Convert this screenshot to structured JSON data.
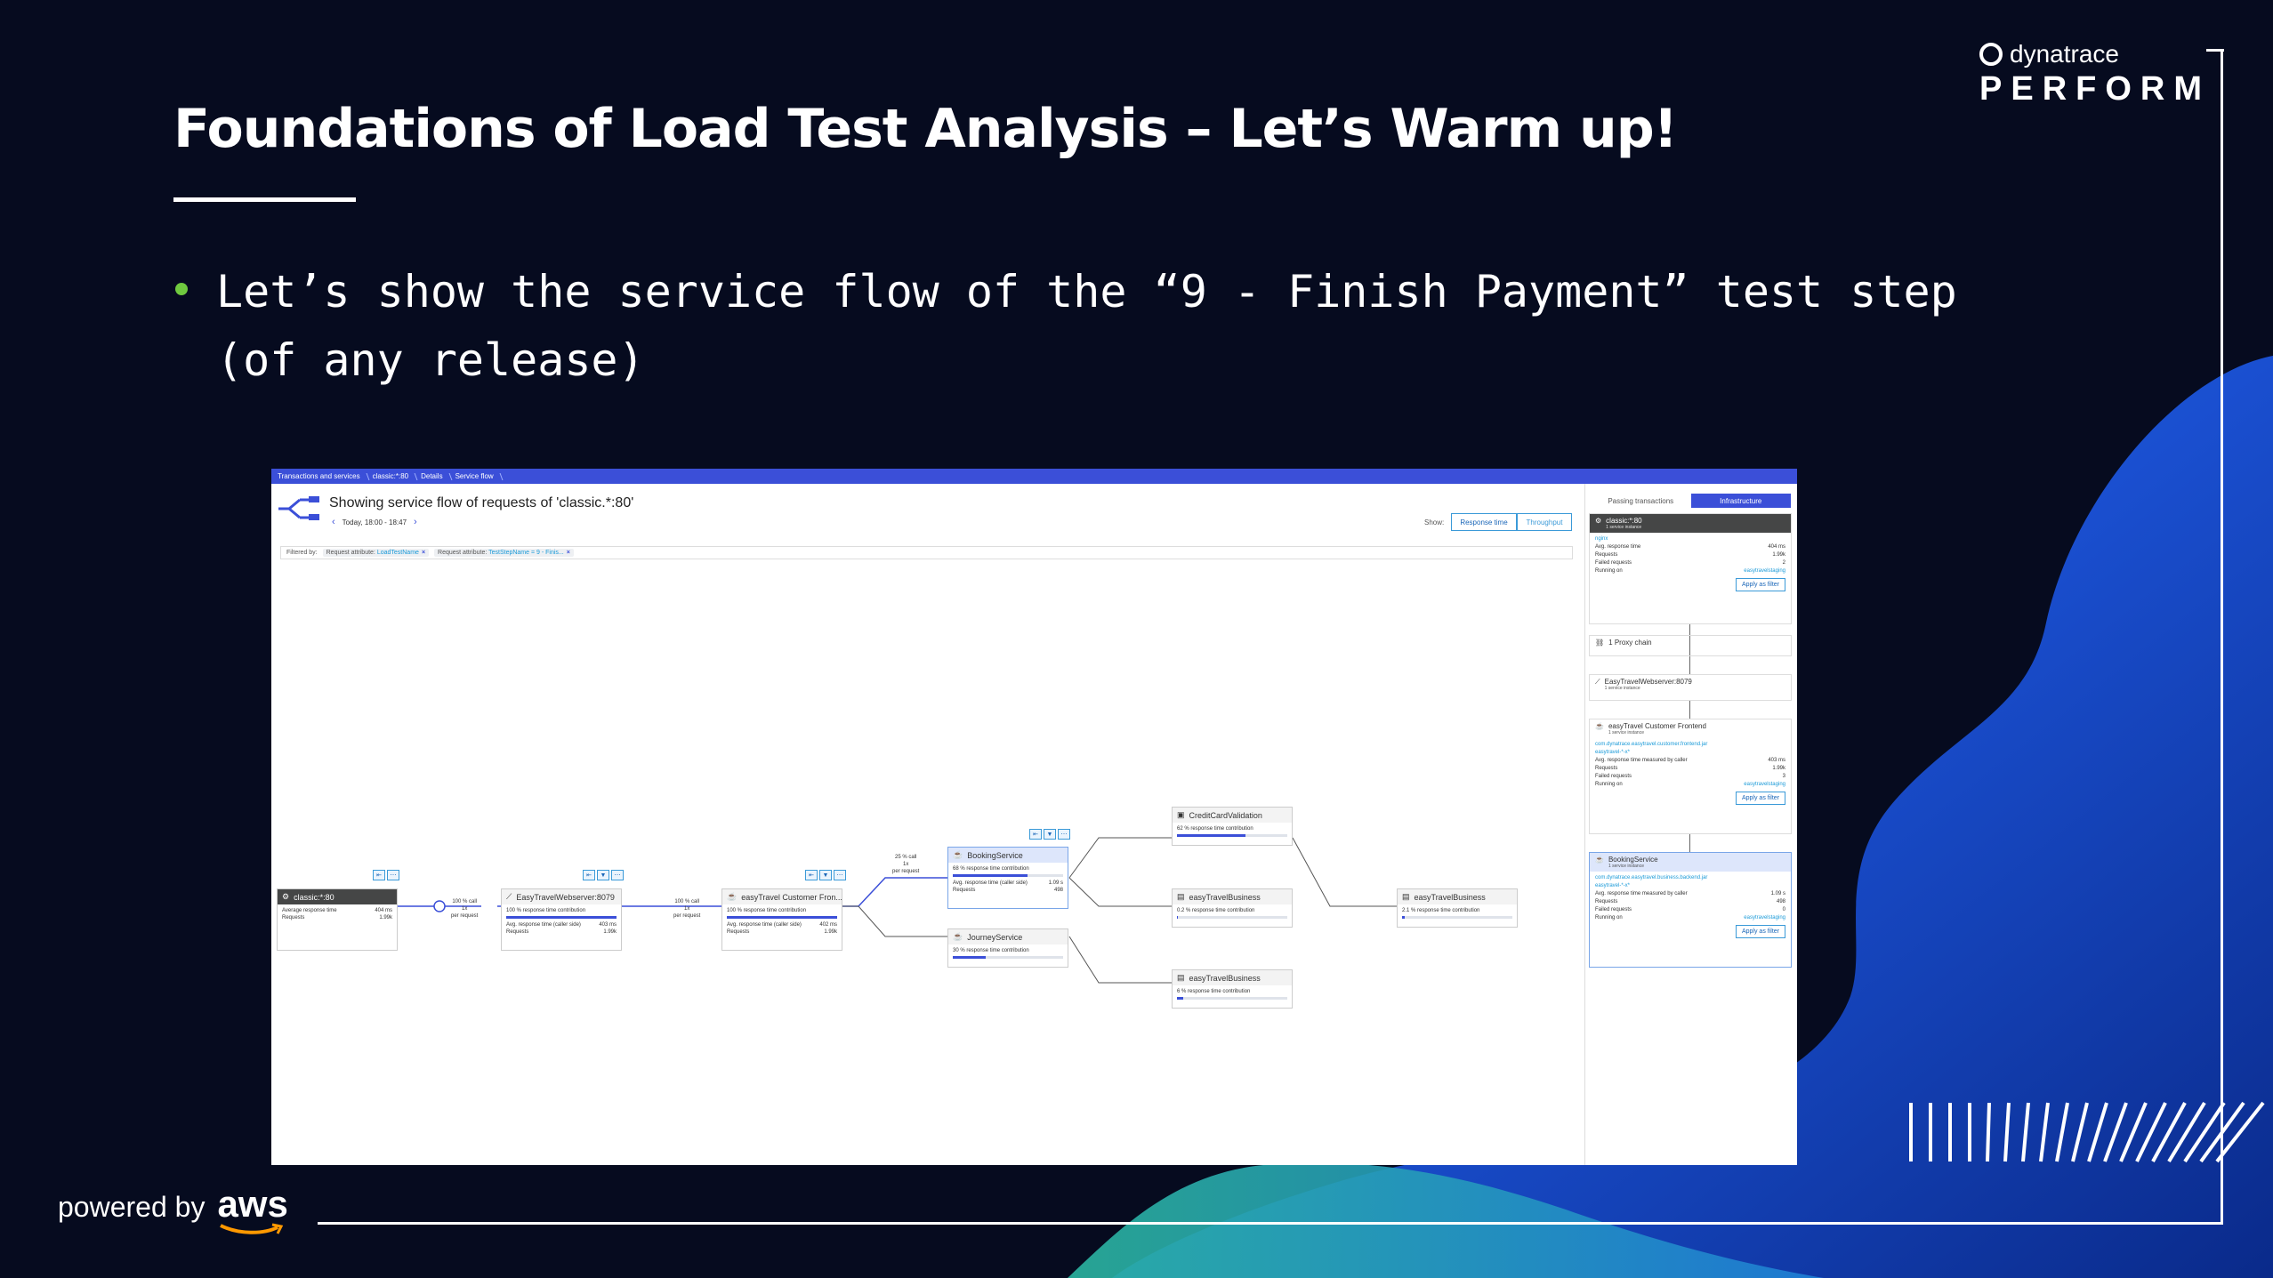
{
  "slide": {
    "title": "Foundations of Load Test Analysis – Let’s Warm up!",
    "bullet": "Let’s show the service flow of the “9 - Finish Payment” test step (of any release)",
    "brand_name": "dynatrace",
    "brand_event": "PERFORM",
    "powered_by": "powered by",
    "aws": "aws"
  },
  "colors": {
    "background": "#060b1f",
    "accent_blue": "#3b4fd8",
    "bullet_green": "#6fc93f"
  },
  "screenshot": {
    "breadcrumbs": [
      "Transactions and services",
      "classic:*:80",
      "Details",
      "Service flow"
    ],
    "title": "Showing service flow of requests of 'classic.*:80'",
    "timeframe": "Today, 18:00 - 18:47",
    "show_label": "Show:",
    "toggle_response": "Response time",
    "toggle_throughput": "Throughput",
    "filter_label": "Filtered by:",
    "filters": [
      {
        "key": "Request attribute:",
        "value": "LoadTestName"
      },
      {
        "key": "Request attribute:",
        "value": "TestStepName = 9 - Finis..."
      }
    ],
    "nodes": {
      "classic": {
        "name": "classic:*:80",
        "r1l": "Average response time",
        "r1v": "404 ms",
        "r2l": "Requests",
        "r2v": "1.99k"
      },
      "webserver": {
        "name": "EasyTravelWebserver:8079",
        "contrib": "100 % response time contribution",
        "r1l": "Avg. response time (caller side)",
        "r1v": "403 ms",
        "r2l": "Requests",
        "r2v": "1.99k"
      },
      "frontend": {
        "name": "easyTravel Customer Fron...",
        "contrib": "100 % response time contribution",
        "r1l": "Avg. response time (caller side)",
        "r1v": "402 ms",
        "r2l": "Requests",
        "r2v": "1.99k"
      },
      "booking": {
        "name": "BookingService",
        "contrib": "68 % response time contribution",
        "r1l": "Avg. response time (caller side)",
        "r1v": "1.09 s",
        "r2l": "Requests",
        "r2v": "498"
      },
      "journey": {
        "name": "JourneyService",
        "contrib": "30 % response time contribution"
      },
      "credit": {
        "name": "CreditCardValidation",
        "contrib": "62 % response time contribution"
      },
      "business1": {
        "name": "easyTravelBusiness",
        "contrib": "0.2 % response time contribution"
      },
      "business2": {
        "name": "easyTravelBusiness",
        "contrib": "6 % response time contribution"
      },
      "business3": {
        "name": "easyTravelBusiness",
        "contrib": "2.1 % response time contribution"
      }
    },
    "contributions": {
      "webserver": 100,
      "frontend": 100,
      "booking": 68,
      "journey": 30,
      "credit": 62,
      "business1": 0.2,
      "business2": 6,
      "business3": 2.1
    },
    "edges": {
      "e1": {
        "pct": "100 % call",
        "per": "1x",
        "per_label": "per request"
      },
      "e2": {
        "pct": "100 % call",
        "per": "1x",
        "per_label": "per request"
      },
      "e3": {
        "pct": "25 % call",
        "per": "1x",
        "per_label": "per request"
      }
    },
    "panel": {
      "tab1": "Passing transactions",
      "tab2": "Infrastructure",
      "classic_name": "classic:*:80",
      "classic_sub": "1 service instance",
      "classic_link": "nginx",
      "classic_rows": [
        {
          "l": "Avg. response time",
          "v": "404 ms"
        },
        {
          "l": "Requests",
          "v": "1.99k"
        },
        {
          "l": "Failed requests",
          "v": "2"
        },
        {
          "l": "Running on",
          "v": "easytravelstaging"
        }
      ],
      "apply": "Apply as filter",
      "proxy": "1 Proxy chain",
      "webserver_name": "EasyTravelWebserver:8079",
      "webserver_sub": "1 service instance",
      "frontend_name": "easyTravel Customer Frontend",
      "frontend_sub": "1 service instance",
      "frontend_link1": "com.dynatrace.easytravel.customer.frontend.jar",
      "frontend_link2": "easytravel-*-x*",
      "frontend_rows": [
        {
          "l": "Avg. response time measured by caller",
          "v": "403 ms"
        },
        {
          "l": "Requests",
          "v": "1.99k"
        },
        {
          "l": "Failed requests",
          "v": "3"
        },
        {
          "l": "Running on",
          "v": "easytravelstaging"
        }
      ],
      "booking_name": "BookingService",
      "booking_sub": "1 service instance",
      "booking_link1": "com.dynatrace.easytravel.business.backend.jar",
      "booking_link2": "easytravel-*-x*",
      "booking_rows": [
        {
          "l": "Avg. response time measured by caller",
          "v": "1.09 s"
        },
        {
          "l": "Requests",
          "v": "498"
        },
        {
          "l": "Failed requests",
          "v": "0"
        },
        {
          "l": "Running on",
          "v": "easytravelstaging"
        }
      ]
    }
  }
}
